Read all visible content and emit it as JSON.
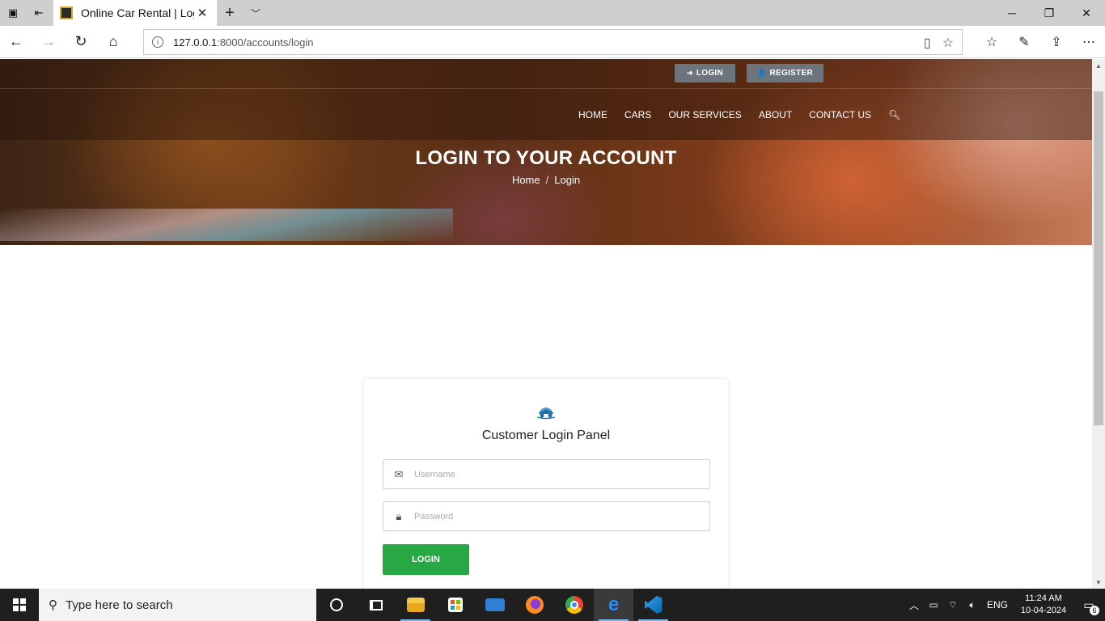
{
  "browser": {
    "tab_title": "Online Car Rental | Logi",
    "address_host": "127.0.0.1",
    "address_path": ":8000/accounts/login"
  },
  "site": {
    "top_buttons": {
      "login": "LOGIN",
      "register": "REGISTER"
    },
    "menu": [
      "HOME",
      "CARS",
      "OUR SERVICES",
      "ABOUT",
      "CONTACT US"
    ],
    "hero_title": "LOGIN TO YOUR ACCOUNT",
    "breadcrumb": {
      "home": "Home",
      "separator": "/",
      "current": "Login"
    }
  },
  "login_panel": {
    "title": "Customer Login Panel",
    "username_placeholder": "Username",
    "password_placeholder": "Password",
    "submit_label": "LOGIN"
  },
  "taskbar": {
    "search_placeholder": "Type here to search",
    "language": "ENG",
    "time": "11:24 AM",
    "date": "10-04-2024",
    "notification_count": "6"
  },
  "colors": {
    "login_button": "#28a745",
    "top_button": "#6c757d",
    "taskbar": "#1f1f1f"
  }
}
